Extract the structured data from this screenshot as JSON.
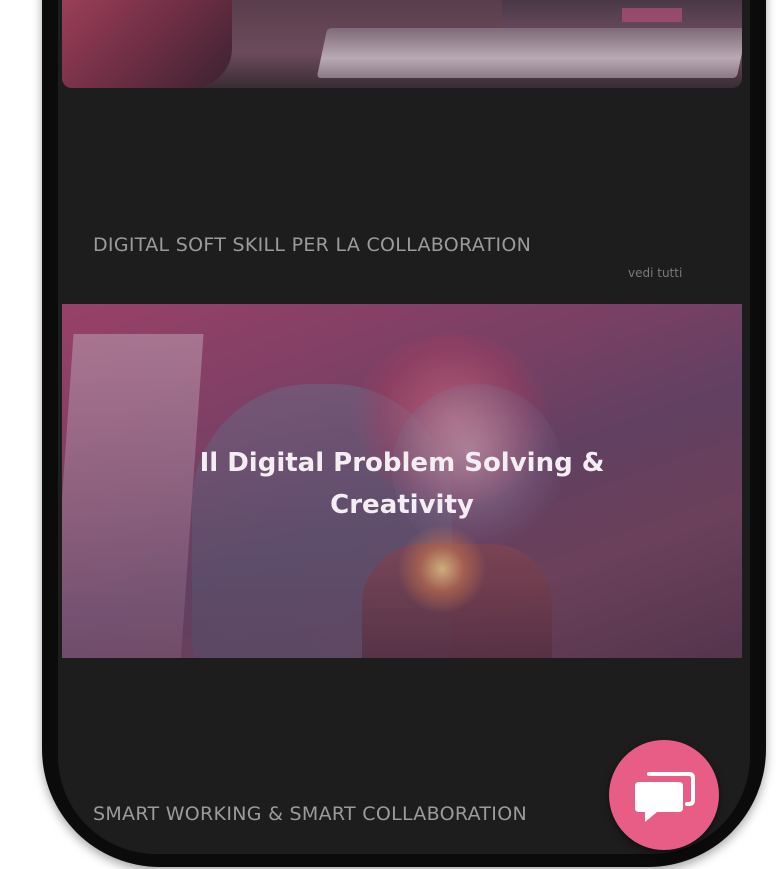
{
  "sections": [
    {
      "title": "DIGITAL SOFT SKILL PER LA COLLABORATION",
      "see_all": "vedi tutti"
    },
    {
      "title": "SMART WORKING & SMART COLLABORATION",
      "see_all": ""
    }
  ],
  "feature_card": {
    "title_line1": "Il Digital Problem Solving &",
    "title_line2": "Creativity"
  },
  "chat_button": {
    "icon": "chat-bubble-icon"
  },
  "colors": {
    "screen_bg": "#1d1d1d",
    "frame": "#0b0b0b",
    "section_title": "#9b9b9b",
    "chat_button": "#e85d86",
    "feature_title": "#f4eef2"
  }
}
